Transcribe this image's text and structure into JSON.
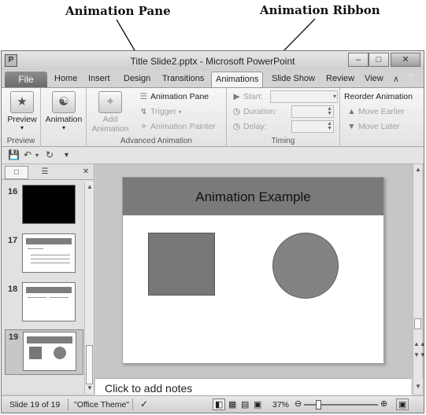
{
  "callouts": {
    "animation_pane": "Animation Pane",
    "animation_ribbon": "Animation Ribbon"
  },
  "window": {
    "app_icon": "P",
    "title": "Title Slide2.pptx - Microsoft PowerPoint",
    "minimize_icon": "minimize-icon",
    "maximize_icon": "maximize-icon",
    "close_icon": "close-icon"
  },
  "tabs": {
    "file": "File",
    "items": [
      "Home",
      "Insert",
      "Design",
      "Transitions",
      "Animations",
      "Slide Show",
      "Review",
      "View"
    ],
    "active": "Animations"
  },
  "ribbon": {
    "preview_group": {
      "button": "Preview",
      "label": "Preview"
    },
    "animation_group": {
      "button": "Animation"
    },
    "advanced_group": {
      "add_animation_line1": "Add",
      "add_animation_line2": "Animation",
      "animation_pane": "Animation Pane",
      "trigger": "Trigger",
      "animation_painter": "Animation Painter",
      "label": "Advanced Animation"
    },
    "timing_group": {
      "start": "Start:",
      "duration": "Duration:",
      "delay": "Delay:",
      "label": "Timing"
    },
    "reorder_group": {
      "title": "Reorder Animation",
      "move_earlier": "Move Earlier",
      "move_later": "Move Later"
    }
  },
  "slides_panel": {
    "thumbnails": [
      {
        "number": "16"
      },
      {
        "number": "17"
      },
      {
        "number": "18"
      },
      {
        "number": "19"
      }
    ],
    "selected": "19"
  },
  "slide": {
    "title": "Animation Example"
  },
  "notes": {
    "placeholder": "Click to add notes"
  },
  "status": {
    "slide_info": "Slide 19 of 19",
    "theme": "\"Office Theme\"",
    "zoom": "37%",
    "zoom_level": 0.37
  },
  "colors": {
    "slide_header": "#7a7a7a",
    "file_tab": "#7c7c7c",
    "canvas": "#c6c6c6"
  }
}
